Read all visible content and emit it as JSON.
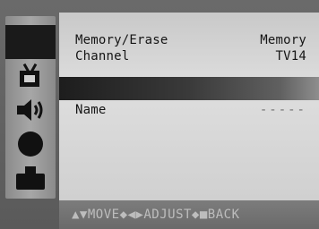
{
  "menu": {
    "rail": {
      "items": [
        {
          "icon": "blank-active-icon"
        },
        {
          "icon": "tv-icon"
        },
        {
          "icon": "speaker-icon"
        },
        {
          "icon": "circle-icon"
        },
        {
          "icon": "plug-icon"
        }
      ]
    },
    "rows": {
      "memory": {
        "label": "Memory/Erase",
        "value": "Memory"
      },
      "channel": {
        "label": "Channel",
        "value": "TV14"
      },
      "name": {
        "label": "Name",
        "value": "-----"
      }
    },
    "footer": {
      "hint": "▲▼MOVE◆◀▶ADJUST◆■BACK"
    }
  },
  "colors": {
    "panel": "#d6d6d6",
    "highlight": "#222222",
    "footer": "#737373"
  }
}
